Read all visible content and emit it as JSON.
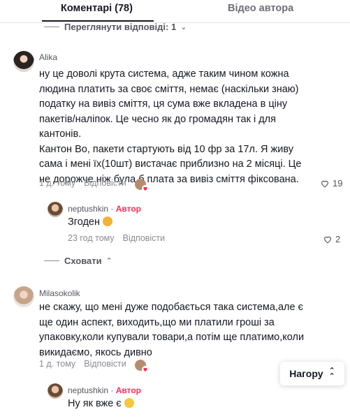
{
  "tabs": {
    "comments": "Коментарі (78)",
    "author_videos": "Відео автора"
  },
  "toggles": {
    "view_replies": "Переглянути відповіді: 1",
    "hide": "Сховати"
  },
  "comments": [
    {
      "username": "Alika",
      "text_lines": [
        "ну це доволі крута система, адже таким чином кожна",
        "людина платить за своє сміття, немає (наскільки знаю)",
        "податку на вивіз сміття, ця сума вже вкладена в ціну",
        "пакетів/наліпок. Це чесно як до громадян так і для",
        "кантонів.",
        "Кантон Во, пакети стартують від 10 фр за 17л. Я живу",
        "сама і мені їх(10шт) вистачає приблизно на 2 місяці. Це",
        "не дорожче ніж була б плата за вивіз сміття фіксована."
      ],
      "time": "1 д. тому",
      "reply_label": "Відповісти",
      "likes": "19"
    },
    {
      "username": "Milasokolik",
      "text_lines": [
        "не скажу, що мені дуже подобається така система,але є",
        "ще один аспект, виходить,що ми платили гроші за",
        "упаковку,коли купували товари,а потім ще платимо,коли",
        "викидаємо, якось дивно"
      ],
      "time": "1 д. тому",
      "reply_label": "Відповісти"
    }
  ],
  "replies": [
    {
      "username": "neptushkin",
      "author_label": "Автор",
      "separator": " · ",
      "text": "Згоден",
      "time": "23 год тому",
      "reply_label": "Відповісти",
      "likes": "2"
    },
    {
      "username": "neptushkin",
      "author_label": "Автор",
      "separator": " · ",
      "text": "Ну як вже є"
    }
  ],
  "back_to_top": "Нагору",
  "colors": {
    "accent": "#fe2c55",
    "text": "#161823",
    "muted": "#8a8b91"
  },
  "icons": [
    "heart-outline-icon",
    "chevron-up-icon",
    "double-chevron-up-icon",
    "heart-hands-emoji",
    "grin-emoji"
  ]
}
